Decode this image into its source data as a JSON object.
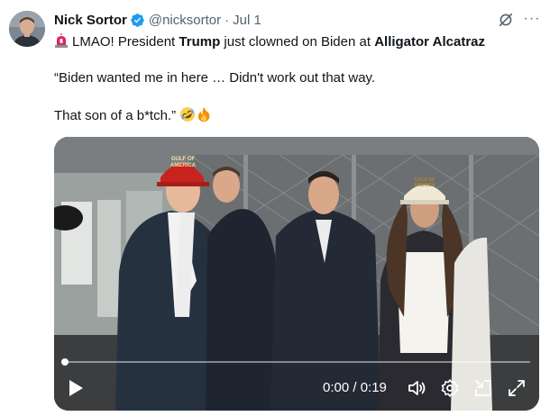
{
  "author": {
    "name": "Nick Sortor",
    "handle": "@nicksortor",
    "separator": "·",
    "date": "Jul 1"
  },
  "tweet": {
    "line1": {
      "pre": "LMAO! President ",
      "bold1": "Trump",
      "mid": " just clowned on Biden at ",
      "bold2": "Alligator Alcatraz"
    },
    "line2": "“Biden wanted me in here … Didn't work out that way.",
    "line3": "That son of a b*tch.”"
  },
  "video": {
    "time": "0:00 / 0:19",
    "progress": 0,
    "hat_text_left": "GULF OF AMERICA",
    "hat_text_right": "GULF OF AMERICA"
  },
  "icons": {
    "verified": "verified-badge-icon",
    "grok": "grok-icon",
    "more": "more-icon",
    "siren": "rotating-light-emoji",
    "laugh": "rolling-on-floor-laughing-emoji",
    "fire": "fire-emoji",
    "play": "play-icon",
    "volume": "volume-icon",
    "settings": "settings-icon",
    "dock": "dock-icon",
    "fullscreen": "fullscreen-icon"
  },
  "colors": {
    "verified": "#1d9bf0",
    "text": "#0f1419",
    "secondary": "#536471"
  }
}
